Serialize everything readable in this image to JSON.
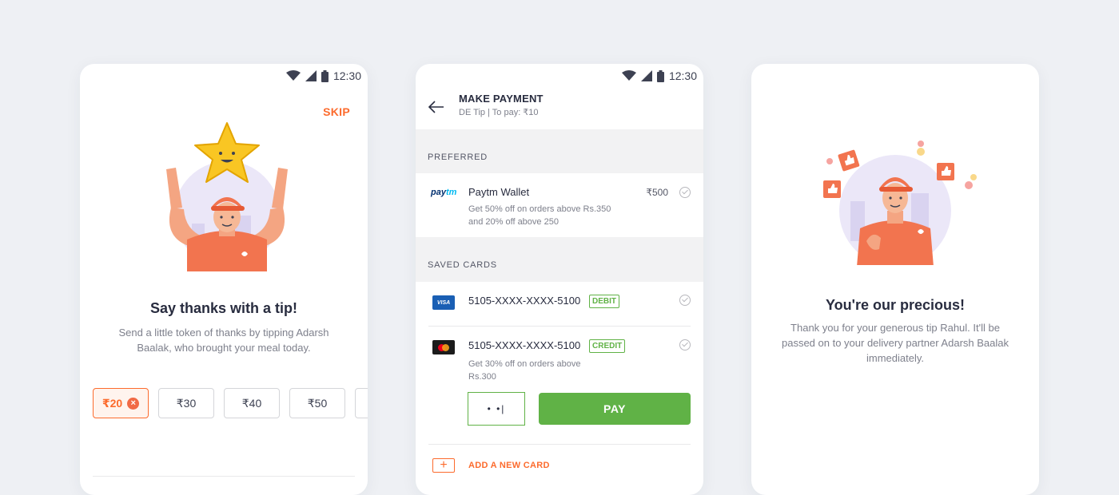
{
  "status": {
    "time": "12:30"
  },
  "screen1": {
    "skip": "SKIP",
    "title": "Say thanks with a tip!",
    "subtitle": "Send a little token of thanks by tipping Adarsh Baalak, who brought your meal today.",
    "tips": [
      {
        "label": "₹20",
        "selected": true
      },
      {
        "label": "₹30"
      },
      {
        "label": "₹40"
      },
      {
        "label": "₹50"
      }
    ]
  },
  "screen2": {
    "title": "MAKE PAYMENT",
    "subtitle": "DE Tip | To pay: ₹10",
    "preferred_label": "PREFERRED",
    "paytm": {
      "logo_a": "pay",
      "logo_b": "tm",
      "name": "Paytm Wallet",
      "amount": "₹500",
      "offer": "Get 50% off on orders above Rs.350 and 20% off above 250"
    },
    "saved_cards_label": "SAVED CARDS",
    "card1": {
      "logo": "VISA",
      "number": "5105-XXXX-XXXX-5100",
      "type": "DEBIT"
    },
    "card2": {
      "number": "5105-XXXX-XXXX-5100",
      "type": "CREDIT",
      "offer": "Get 30% off on orders above Rs.300"
    },
    "cvv_value": "• •|",
    "pay_label": "PAY",
    "add_card_icon": "+",
    "add_card_label": "ADD A NEW CARD"
  },
  "screen3": {
    "title": "You're our precious!",
    "subtitle": "Thank you for your generous tip Rahul. It'll be passed on to your delivery partner Adarsh Baalak immediately."
  },
  "colors": {
    "accent": "#fc6b2d",
    "success": "#60b246",
    "text": "#282c3f",
    "muted": "#7e808c"
  }
}
